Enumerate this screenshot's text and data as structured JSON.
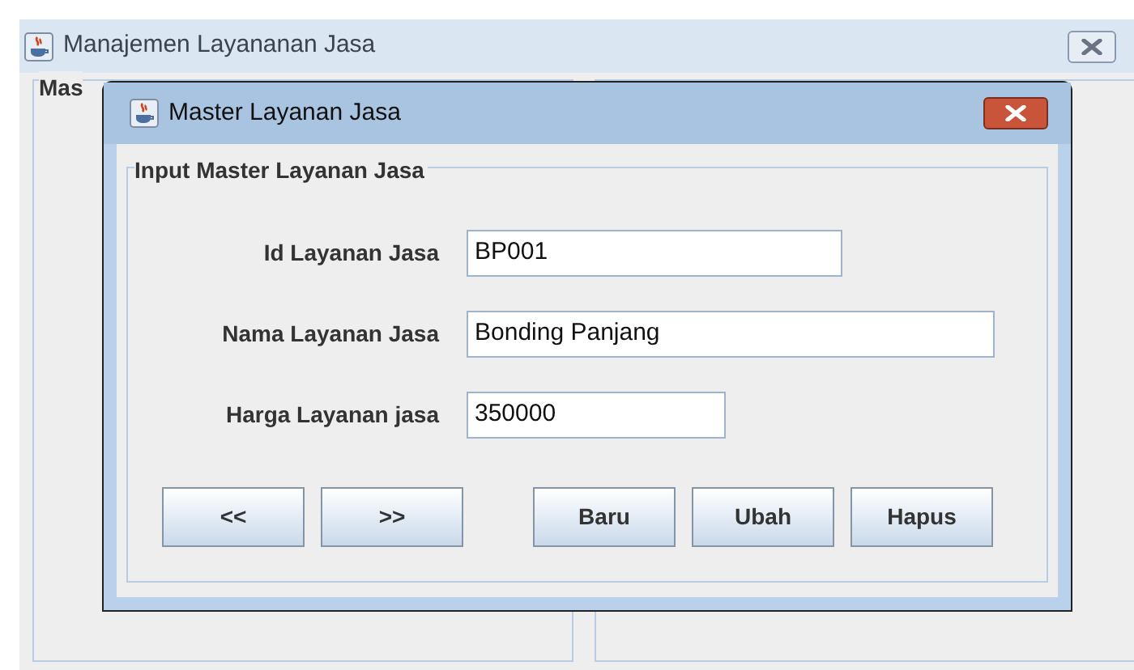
{
  "main_window": {
    "title": "Manajemen Layananan Jasa",
    "panel_title": "Mas"
  },
  "dialog": {
    "title": "Master Layanan Jasa",
    "group_title": "Input Master Layanan Jasa",
    "fields": [
      {
        "label": "Id Layanan Jasa",
        "value": "BP001"
      },
      {
        "label": "Nama Layanan Jasa",
        "value": "Bonding Panjang"
      },
      {
        "label": "Harga Layanan jasa",
        "value": "350000"
      }
    ],
    "buttons": [
      "<<",
      ">>",
      "Baru",
      "Ubah",
      "Hapus"
    ]
  }
}
